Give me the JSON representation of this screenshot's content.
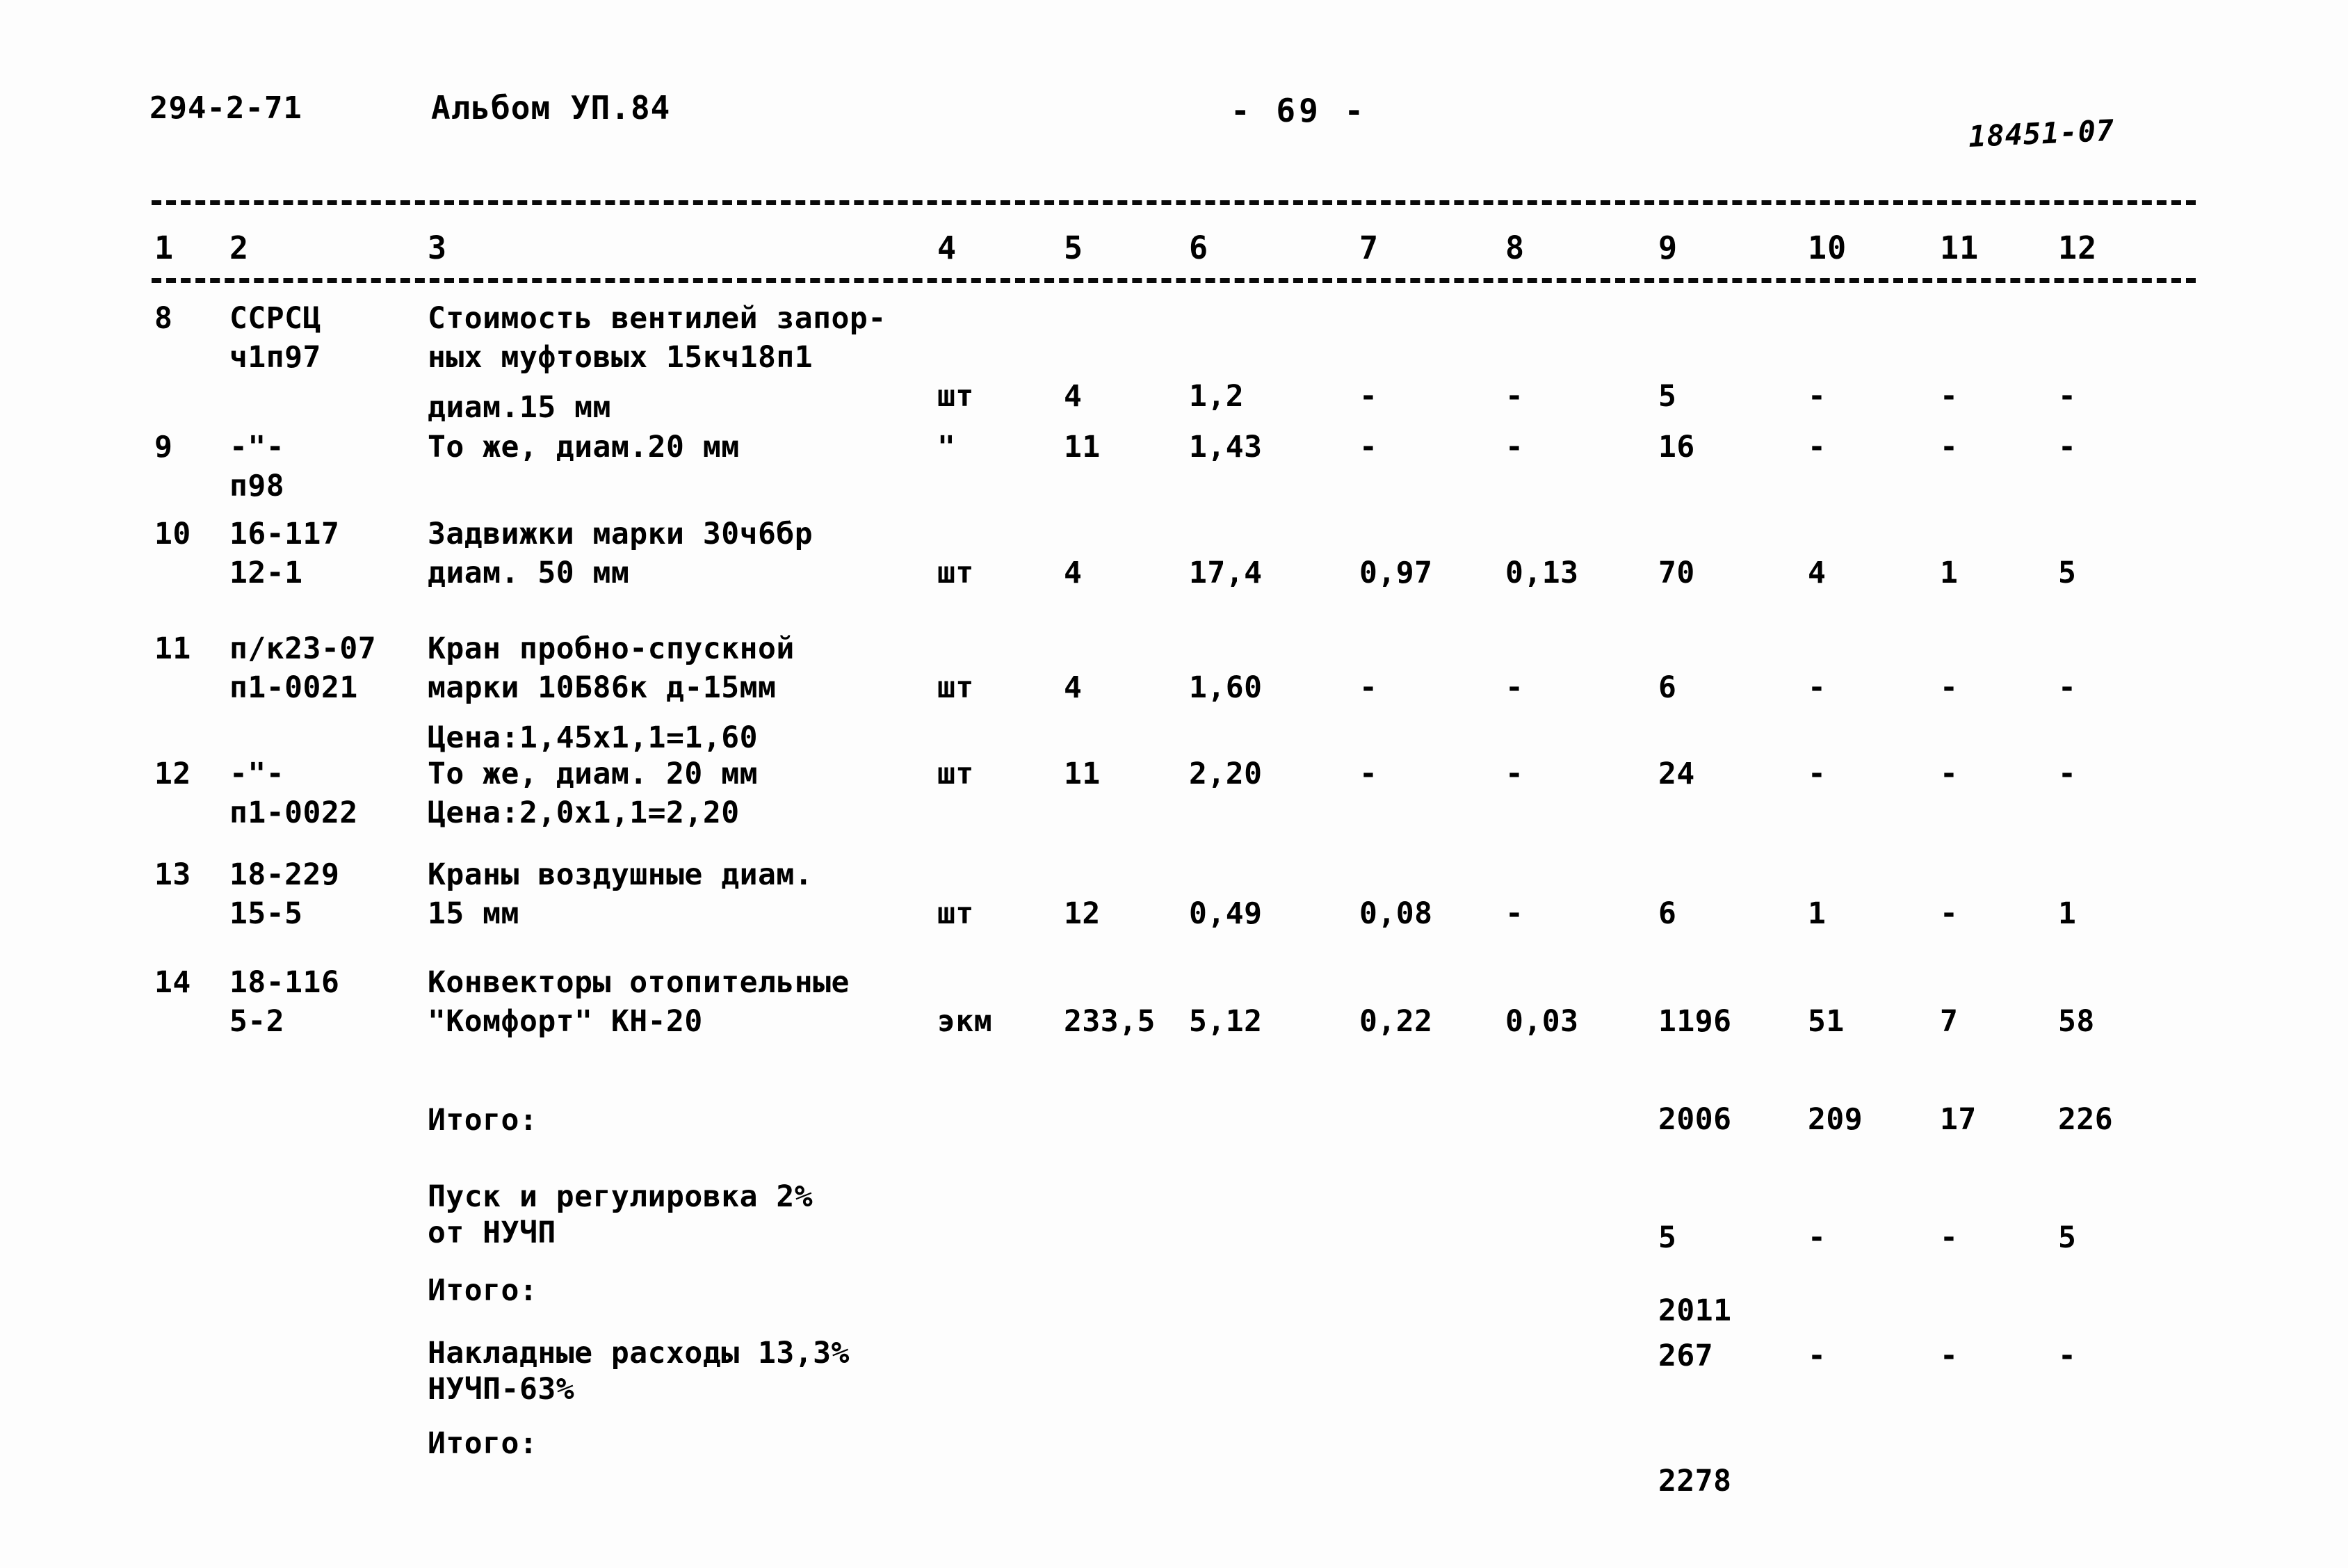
{
  "header": {
    "doc_code": "294-2-71",
    "album": "Альбом УП.84",
    "page_marker": "- 69 -",
    "stamp": "18451-07"
  },
  "table": {
    "column_numbers": [
      "1",
      "2",
      "3",
      "4",
      "5",
      "6",
      "7",
      "8",
      "9",
      "10",
      "11",
      "12"
    ],
    "rows": [
      {
        "num": "8",
        "code_line1": "ССРСЦ",
        "code_line2": "ч1п97",
        "desc_line1": "Стоимость вентилей запор-",
        "desc_line2": "ных муфтовых 15кч18п1",
        "desc_line3": "диам.15 мм",
        "unit": "шт",
        "qty": "4",
        "price": "1,2",
        "col7": "-",
        "col8": "-",
        "col9": "5",
        "col10": "-",
        "col11": "-",
        "col12": "-"
      },
      {
        "num": "9",
        "code_line1": "-\"-",
        "code_line2": "п98",
        "desc_line1": "То же, диам.20 мм",
        "desc_line2": "",
        "desc_line3": "",
        "unit": "\"",
        "qty": "11",
        "price": "1,43",
        "col7": "-",
        "col8": "-",
        "col9": "16",
        "col10": "-",
        "col11": "-",
        "col12": "-"
      },
      {
        "num": "10",
        "code_line1": "16-117",
        "code_line2": "12-1",
        "desc_line1": "Задвижки марки 30ч6бр",
        "desc_line2": "диам. 50 мм",
        "desc_line3": "",
        "unit": "шт",
        "qty": "4",
        "price": "17,4",
        "col7": "0,97",
        "col8": "0,13",
        "col9": "70",
        "col10": "4",
        "col11": "1",
        "col12": "5"
      },
      {
        "num": "11",
        "code_line1": "п/к23-07",
        "code_line2": "п1-0021",
        "desc_line1": "Кран пробно-спускной",
        "desc_line2": "марки 10Б86к д-15мм",
        "desc_line3": "Цена:1,45х1,1=1,60",
        "unit": "шт",
        "qty": "4",
        "price": "1,60",
        "col7": "-",
        "col8": "-",
        "col9": "6",
        "col10": "-",
        "col11": "-",
        "col12": "-"
      },
      {
        "num": "12",
        "code_line1": "-\"-",
        "code_line2": "п1-0022",
        "desc_line1": "То же, диам. 20 мм",
        "desc_line2": "Цена:2,0х1,1=2,20",
        "desc_line3": "",
        "unit": "шт",
        "qty": "11",
        "price": "2,20",
        "col7": "-",
        "col8": "-",
        "col9": "24",
        "col10": "-",
        "col11": "-",
        "col12": "-"
      },
      {
        "num": "13",
        "code_line1": "18-229",
        "code_line2": "15-5",
        "desc_line1": "Краны воздушные диам.",
        "desc_line2": "15 мм",
        "desc_line3": "",
        "unit": "шт",
        "qty": "12",
        "price": "0,49",
        "col7": "0,08",
        "col8": "-",
        "col9": "6",
        "col10": "1",
        "col11": "-",
        "col12": "1"
      },
      {
        "num": "14",
        "code_line1": "18-116",
        "code_line2": "5-2",
        "desc_line1": "Конвекторы отопительные",
        "desc_line2": "\"Комфорт\" КН-20",
        "desc_line3": "",
        "unit": "экм",
        "qty": "233,5",
        "price": "5,12",
        "col7": "0,22",
        "col8": "0,03",
        "col9": "1196",
        "col10": "51",
        "col11": "7",
        "col12": "58"
      }
    ],
    "summary": [
      {
        "label_line1": "Итого:",
        "label_line2": "",
        "col9": "2006",
        "col10": "209",
        "col11": "17",
        "col12": "226"
      },
      {
        "label_line1": "Пуск и регулировка 2%",
        "label_line2": "от НУЧП",
        "col9": "5",
        "col10": "-",
        "col11": "-",
        "col12": "5"
      },
      {
        "label_line1": "Итого:",
        "label_line2": "",
        "col9": "2011",
        "col10": "",
        "col11": "",
        "col12": ""
      },
      {
        "label_line1": "Накладные расходы 13,3%",
        "label_line2": "НУЧП-63%",
        "col9": "267",
        "col10": "-",
        "col11": "-",
        "col12": "-"
      },
      {
        "label_line1": "Итого:",
        "label_line2": "",
        "col9": "2278",
        "col10": "",
        "col11": "",
        "col12": ""
      }
    ]
  }
}
